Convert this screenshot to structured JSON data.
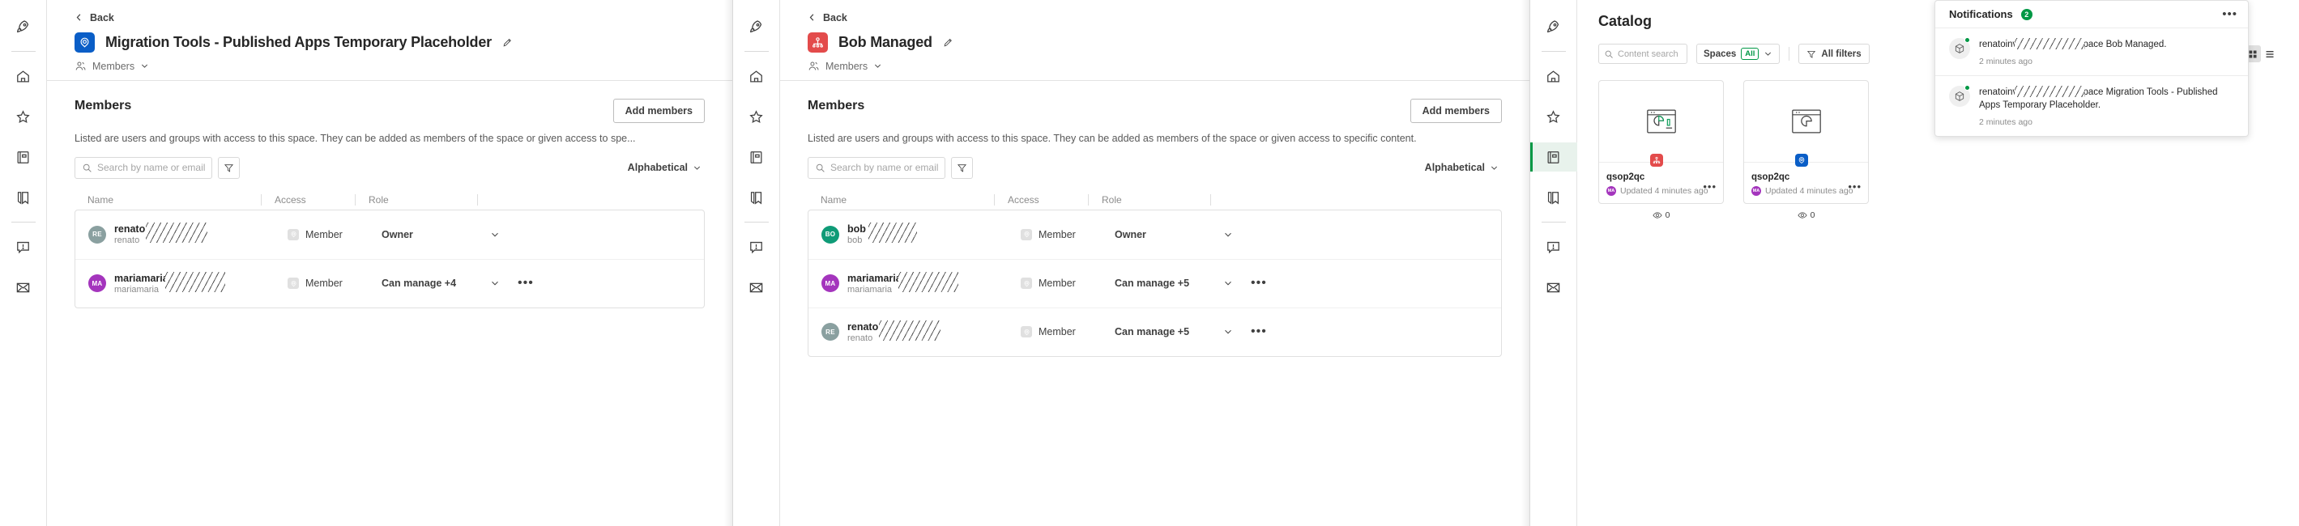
{
  "rail": {
    "items": [
      {
        "name": "rocket-icon",
        "label": "Launcher"
      },
      {
        "name": "home-icon",
        "label": "Home"
      },
      {
        "name": "star-icon",
        "label": "Favorites"
      },
      {
        "name": "catalog-icon",
        "label": "Catalog"
      },
      {
        "name": "collections-icon",
        "label": "Collections"
      },
      {
        "name": "alerts-icon",
        "label": "Alerts"
      },
      {
        "name": "mail-icon",
        "label": "Subscriptions"
      }
    ]
  },
  "panel1": {
    "back_label": "Back",
    "space_icon": "shared-space-icon",
    "space_icon_color": "#0a5ec7",
    "space_title": "Migration Tools - Published Apps Temporary Placeholder",
    "edit_icon": "pencil-icon",
    "sub_label": "Members",
    "members": {
      "title": "Members",
      "add_label": "Add members",
      "description": "Listed are users and groups with access to this space. They can be added as members of the space or given access to spe...",
      "search_placeholder": "Search by name or email",
      "search_value": "",
      "filter_icon": "filter-icon",
      "sort_label": "Alphabetical",
      "columns": [
        "Name",
        "Access",
        "Role"
      ],
      "rows": [
        {
          "initials": "RE",
          "avatar_color": "#8aa0a0",
          "name_top": "renato",
          "name_bottom": "renato",
          "access": "Member",
          "role": "Owner",
          "has_more": false
        },
        {
          "initials": "MA",
          "avatar_color": "#a435bd",
          "name_top": "mariamaria",
          "name_bottom": "mariamaria",
          "access": "Member",
          "role": "Can manage +4",
          "has_more": true
        }
      ]
    }
  },
  "panel2": {
    "back_label": "Back",
    "space_icon": "managed-space-icon",
    "space_icon_color": "#e34b4b",
    "space_title": "Bob Managed",
    "edit_icon": "pencil-icon",
    "sub_label": "Members",
    "members": {
      "title": "Members",
      "add_label": "Add members",
      "description": "Listed are users and groups with access to this space. They can be added as members of the space or given access to specific content.",
      "search_placeholder": "Search by name or email",
      "search_value": "",
      "filter_icon": "filter-icon",
      "sort_label": "Alphabetical",
      "columns": [
        "Name",
        "Access",
        "Role"
      ],
      "rows": [
        {
          "initials": "BO",
          "avatar_color": "#0f9b77",
          "name_top": "bob",
          "name_bottom": "bob",
          "access": "Member",
          "role": "Owner",
          "has_more": false
        },
        {
          "initials": "MA",
          "avatar_color": "#a435bd",
          "name_top": "mariamaria",
          "name_bottom": "mariamaria",
          "access": "Member",
          "role": "Can manage +5",
          "has_more": true
        },
        {
          "initials": "RE",
          "avatar_color": "#8aa0a0",
          "name_top": "renato",
          "name_bottom": "renato",
          "access": "Member",
          "role": "Can manage +5",
          "has_more": true
        }
      ]
    }
  },
  "panel3": {
    "title": "Catalog",
    "search_placeholder": "Content search",
    "search_value": "",
    "spaces_label": "Spaces",
    "spaces_tag": "All",
    "all_filters_label": "All filters",
    "view_grid_icon": "grid-view-icon",
    "view_list_icon": "list-view-icon",
    "cards": [
      {
        "name": "qsop2qc",
        "updated": "Updated 4 minutes ago",
        "avatar_initials": "MA",
        "avatar_color": "#a435bd",
        "badge_color": "#e34b4b",
        "badge_icon": "managed-space-icon",
        "views": "0"
      },
      {
        "name": "qsop2qc",
        "updated": "Updated 4 minutes ago",
        "avatar_initials": "MA",
        "avatar_color": "#a435bd",
        "badge_color": "#0a5ec7",
        "badge_icon": "shared-space-icon",
        "views": "0"
      }
    ]
  },
  "notifications": {
    "title": "Notifications",
    "count": "2",
    "more_icon": "overflow-menu-icon",
    "items": [
      {
        "prefix": "renato",
        "suffix": "invited you to the space Bob Managed.",
        "time": "2 minutes ago"
      },
      {
        "prefix": "renato",
        "suffix": "invited you to the space Migration Tools - Published Apps Temporary Placeholder.",
        "time": "2 minutes ago"
      }
    ]
  }
}
